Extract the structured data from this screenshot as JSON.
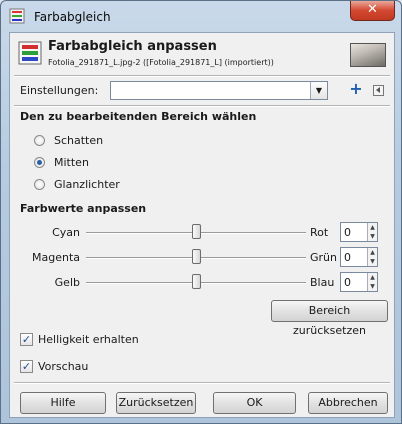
{
  "window": {
    "title": "Farbabgleich",
    "close_label": "✕"
  },
  "header": {
    "title": "Farbabgleich anpassen",
    "subtitle": "Fotolia_291871_L.jpg-2 ([Fotolia_291871_L] (importiert))"
  },
  "settings": {
    "label": "Einstellungen:",
    "value": ""
  },
  "range_section": {
    "title": "Den zu bearbeitenden Bereich wählen",
    "options": [
      {
        "label": "Schatten",
        "selected": false
      },
      {
        "label": "Mitten",
        "selected": true
      },
      {
        "label": "Glanzlichter",
        "selected": false
      }
    ]
  },
  "color_section": {
    "title": "Farbwerte anpassen",
    "sliders": [
      {
        "left": "Cyan",
        "right": "Rot",
        "value": "0",
        "fraction": 0.5
      },
      {
        "left": "Magenta",
        "right": "Grün",
        "value": "0",
        "fraction": 0.5
      },
      {
        "left": "Gelb",
        "right": "Blau",
        "value": "0",
        "fraction": 0.5
      }
    ],
    "reset_label": "Bereich zurücksetzen"
  },
  "checkboxes": [
    {
      "label": "Helligkeit erhalten",
      "checked": true
    },
    {
      "label": "Vorschau",
      "checked": true
    }
  ],
  "buttons": {
    "help": "Hilfe",
    "reset": "Zurücksetzen",
    "ok": "OK",
    "cancel": "Abbrechen"
  },
  "icons": {
    "app": "color-balance-icon",
    "header": "color-balance-icon",
    "add": "plus-icon",
    "menu": "triangle-left-icon",
    "spin": "spin-arrows-icon"
  }
}
